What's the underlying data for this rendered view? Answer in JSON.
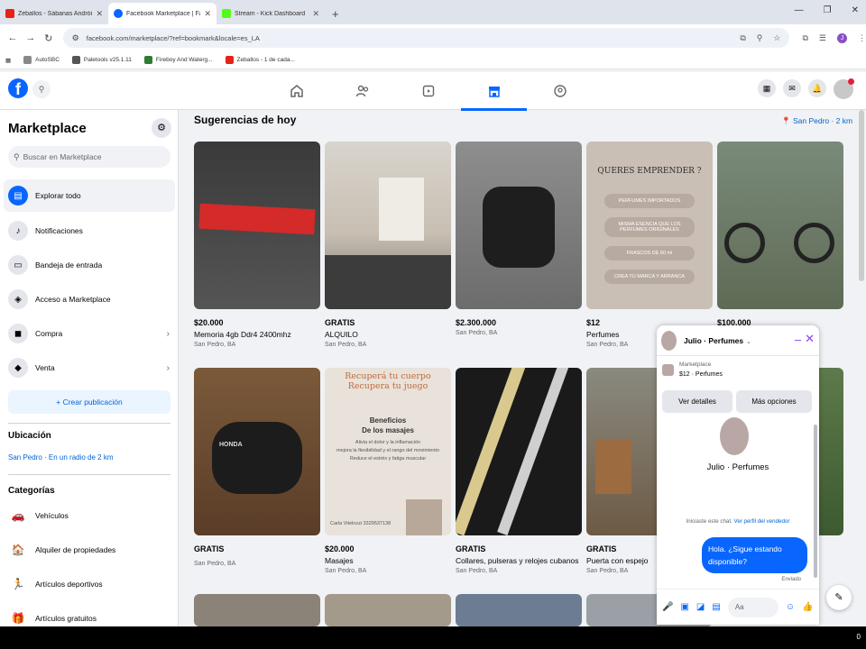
{
  "browser": {
    "tabs": [
      {
        "title": "Zeballos - Sábanas Andrónicas",
        "color": "#e62117"
      },
      {
        "title": "Facebook Marketplace | Facebook",
        "color": "#0866ff"
      },
      {
        "title": "Stream - Kick Dashboard",
        "color": "#53fc18"
      }
    ],
    "url": "facebook.com/marketplace/?ref=bookmark&locale=es_LA",
    "profile_initial": "J",
    "bookmarks": [
      {
        "label": "AutoSBC",
        "color": "#888888"
      },
      {
        "label": "Paletools v25.1.11",
        "color": "#555555"
      },
      {
        "label": "Fireboy And Waterg...",
        "color": "#2e7d32"
      },
      {
        "label": "Zeballos - 1 de cada...",
        "color": "#e62117"
      }
    ]
  },
  "sidebar": {
    "title": "Marketplace",
    "search_placeholder": "Buscar en Marketplace",
    "items": [
      {
        "label": "Explorar todo",
        "icon": "storefront-icon"
      },
      {
        "label": "Notificaciones",
        "icon": "bell-icon"
      },
      {
        "label": "Bandeja de entrada",
        "icon": "inbox-icon"
      },
      {
        "label": "Acceso a Marketplace",
        "icon": "shield-icon"
      },
      {
        "label": "Compra",
        "icon": "bag-icon"
      },
      {
        "label": "Venta",
        "icon": "tag-icon"
      }
    ],
    "create_label": "+ Crear publicación",
    "location_heading": "Ubicación",
    "location_value": "San Pedro · En un radio de 2 km",
    "categories_heading": "Categorías",
    "categories": [
      {
        "label": "Vehículos",
        "icon": "car-icon"
      },
      {
        "label": "Alquiler de propiedades",
        "icon": "house-icon"
      },
      {
        "label": "Artículos deportivos",
        "icon": "runner-icon"
      },
      {
        "label": "Artículos gratuitos",
        "icon": "gift-icon"
      }
    ]
  },
  "main": {
    "title": "Sugerencias de hoy",
    "location": "San Pedro · 2 km",
    "listings": [
      {
        "price": "$20.000",
        "title": "Memoria 4gb Ddr4 2400mhz",
        "location": "San Pedro, BA"
      },
      {
        "price": "GRATIS",
        "title": "ALQUILO",
        "location": "San Pedro, BA"
      },
      {
        "price": "$2.300.000",
        "title": "",
        "location": "San Pedro, BA"
      },
      {
        "price": "$12",
        "title": "Perfumes",
        "location": "San Pedro, BA"
      },
      {
        "price": "$100.000",
        "title": "",
        "location": ""
      },
      {
        "price": "GRATIS",
        "title": "",
        "location": "San Pedro, BA"
      },
      {
        "price": "$20.000",
        "title": "Masajes",
        "location": "San Pedro, BA"
      },
      {
        "price": "GRATIS",
        "title": "Collares, pulseras y relojes cubanos",
        "location": "San Pedro, BA"
      },
      {
        "price": "GRATIS",
        "title": "Puerta con espejo",
        "location": "San Pedro, BA"
      }
    ],
    "promo": {
      "question": "QUERES EMPRENDER ?",
      "pills": [
        "PERFUMES IMPORTADOS",
        "MISMA ESENCIA QUE LOS PERFUMES ORIGINALES",
        "FRASCOS DE 60 ml",
        "CREA TU MARCA Y ARRANCA"
      ]
    },
    "masaje": {
      "line1": "Recuperá tu cuerpo",
      "line2": "Recupera tu juego",
      "heading1": "Beneficios",
      "heading2": "De los masajes",
      "body1": "Alivia el dolor y la inflamación",
      "body2": "mejora la flexibilidad y el rango del movimiento",
      "body3": "Reduce el estrés y fatiga muscular",
      "contact": "Carla Vitelozzi 3329537138"
    }
  },
  "chat": {
    "name": "Julio · Perfumes",
    "context_label": "Marketplace",
    "context_item": "$12 · Perfumes",
    "btn_details": "Ver detalles",
    "btn_more": "Más opciones",
    "started": "Iniciaste este chat.",
    "seller_link": "Ver perfil del vendedor",
    "message": "Hola. ¿Sigue estando disponible?",
    "status": "Enviado",
    "input_placeholder": "Aa"
  },
  "taskbar": {
    "right": "0"
  }
}
